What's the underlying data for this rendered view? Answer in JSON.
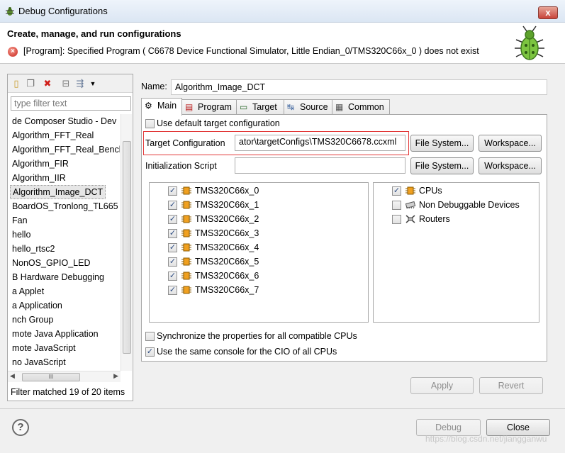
{
  "window": {
    "title": "Debug Configurations",
    "close_glyph": "x"
  },
  "header": {
    "title": "Create, manage, and run configurations",
    "error_message": "[Program]: Specified Program ( C6678 Device Functional Simulator, Little Endian_0/TMS320C66x_0 )  does not exist"
  },
  "left_panel": {
    "filter_placeholder": "type filter text",
    "items": [
      "de Composer Studio - Dev",
      "Algorithm_FFT_Real",
      "Algorithm_FFT_Real_Bench",
      "Algorithm_FIR",
      "Algorithm_IIR",
      "Algorithm_Image_DCT",
      "BoardOS_Tronlong_TL665",
      "Fan",
      "hello",
      "hello_rtsc2",
      "NonOS_GPIO_LED",
      "B Hardware Debugging",
      "a Applet",
      "a Application",
      "nch Group",
      "mote Java Application",
      "mote JavaScript",
      "no JavaScript"
    ],
    "selected_index": 5,
    "filter_status": "Filter matched 19 of 20 items",
    "hscroll_grip": "III"
  },
  "main": {
    "name_label": "Name:",
    "name_value": "Algorithm_Image_DCT",
    "tabs": [
      "Main",
      "Program",
      "Target",
      "Source",
      "Common"
    ],
    "active_tab": "Main",
    "use_default_label": "Use default target configuration",
    "target_config_label": "Target Configuration",
    "target_config_value": "ator\\targetConfigs\\TMS320C6678.ccxml",
    "init_script_label": "Initialization Script",
    "init_script_value": "",
    "file_system_label": "File System...",
    "workspace_label": "Workspace...",
    "cpus": [
      "TMS320C66x_0",
      "TMS320C66x_1",
      "TMS320C66x_2",
      "TMS320C66x_3",
      "TMS320C66x_4",
      "TMS320C66x_5",
      "TMS320C66x_6",
      "TMS320C66x_7"
    ],
    "device_types": [
      "CPUs",
      "Non Debuggable Devices",
      "Routers"
    ],
    "sync_label": "Synchronize the properties for all compatible CPUs",
    "same_console_label": "Use the same console for the CIO of all CPUs",
    "apply_label": "Apply",
    "revert_label": "Revert"
  },
  "footer": {
    "help_glyph": "?",
    "debug_label": "Debug",
    "close_label": "Close",
    "watermark": "https://blog.csdn.net/jiangganwu"
  }
}
